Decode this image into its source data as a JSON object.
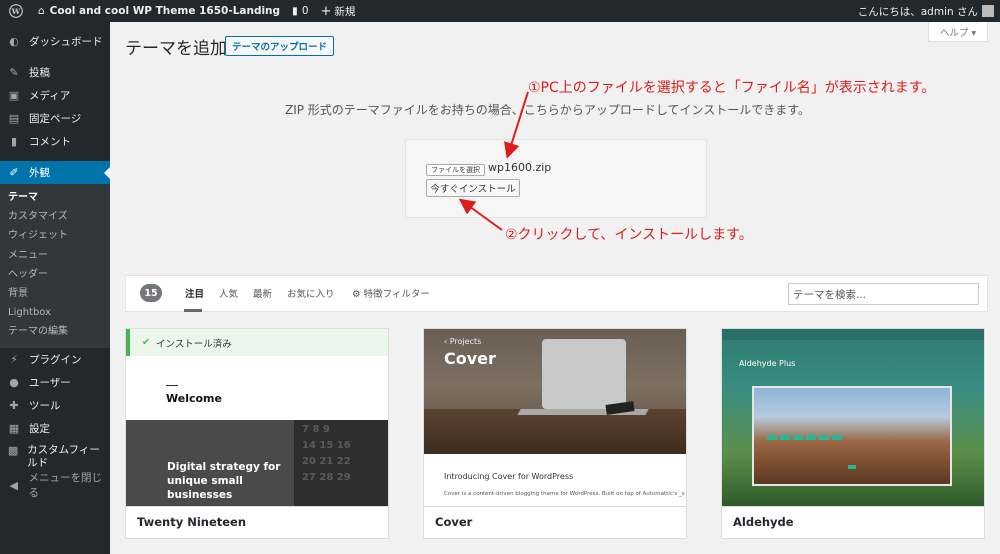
{
  "adminbar": {
    "site_title": "Cool and cool WP Theme 1650-Landing",
    "comments_count": "0",
    "new_label": "新規",
    "greeting": "こんにちは、admin さん"
  },
  "sidebar": {
    "items": [
      {
        "icon": "dashboard-icon",
        "label": "ダッシュボード"
      },
      {
        "icon": "pin-icon",
        "label": "投稿"
      },
      {
        "icon": "media-icon",
        "label": "メディア"
      },
      {
        "icon": "page-icon",
        "label": "固定ページ"
      },
      {
        "icon": "comment-icon",
        "label": "コメント"
      },
      {
        "icon": "paintbrush-icon",
        "label": "外観"
      }
    ],
    "submenu": [
      "テーマ",
      "カスタマイズ",
      "ウィジェット",
      "メニュー",
      "ヘッダー",
      "背景",
      "Lightbox",
      "テーマの編集"
    ],
    "items_after": [
      {
        "icon": "plugin-icon",
        "label": "プラグイン"
      },
      {
        "icon": "user-icon",
        "label": "ユーザー"
      },
      {
        "icon": "tool-icon",
        "label": "ツール"
      },
      {
        "icon": "settings-icon",
        "label": "設定"
      },
      {
        "icon": "custom-field-icon",
        "label": "カスタムフィールド"
      }
    ],
    "collapse_label": "メニューを閉じる"
  },
  "header": {
    "help_label": "ヘルプ ▾",
    "page_title": "テーマを追加",
    "upload_button": "テーマのアップロード"
  },
  "upload": {
    "description": "ZIP 形式のテーマファイルをお持ちの場合、こちらからアップロードしてインストールできます。",
    "choose_file_button": "ファイルを選択",
    "file_name": "wp1600.zip",
    "install_button": "今すぐインストール"
  },
  "annotations": {
    "note1": "①PC上のファイルを選択すると「ファイル名」が表示されます。",
    "note2": "②クリックして、インストールします。",
    "color": "#e01b1b"
  },
  "filter": {
    "count": "15",
    "tabs": [
      "注目",
      "人気",
      "最新",
      "お気に入り"
    ],
    "feature_filter": "特徴フィルター",
    "search_placeholder": "テーマを検索..."
  },
  "themes": [
    {
      "name": "Twenty Nineteen",
      "installed_label": "インストール済み",
      "preview_heading": "Welcome",
      "preview_text": "Digital strategy for unique small businesses"
    },
    {
      "name": "Cover",
      "preview_breadcrumb": "‹ Projects",
      "preview_heading": "Cover",
      "preview_intro": "Introducing Cover for WordPress",
      "preview_small": "Cover is a content-driven blogging theme for WordPress. Built on top of Automattic's _s"
    },
    {
      "name": "Aldehyde",
      "preview_heading": "Aldehyde Plus"
    }
  ],
  "colors": {
    "adminbar_bg": "#23282d",
    "accent": "#0073aa",
    "installed_green": "#46b450"
  }
}
